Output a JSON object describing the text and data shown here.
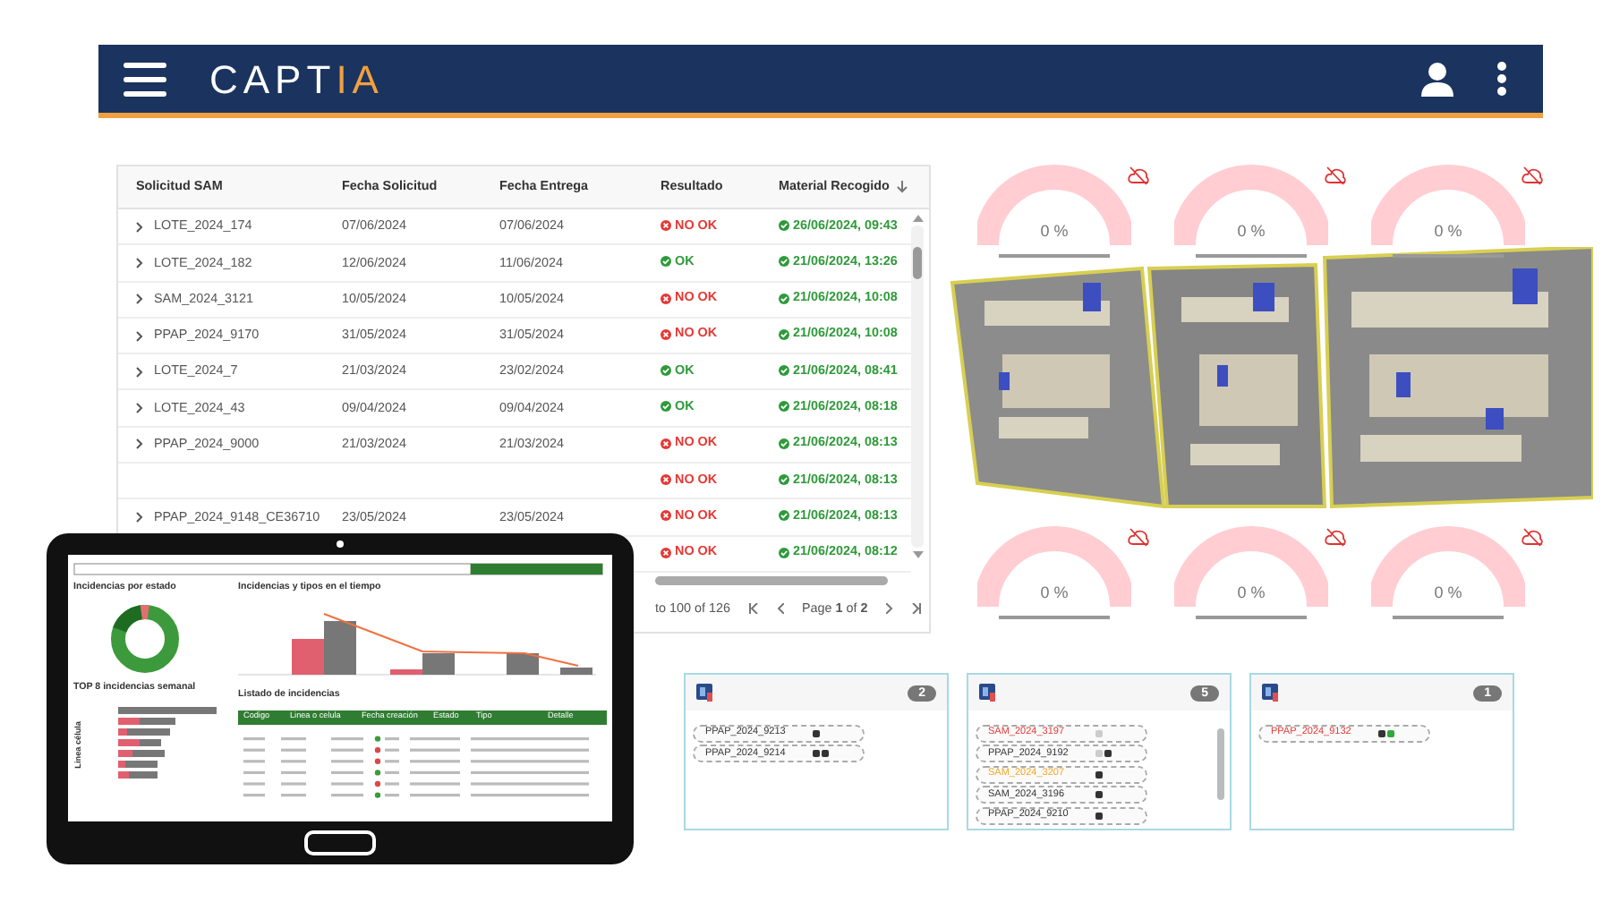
{
  "header": {
    "logo_main": "CAPT",
    "logo_accent": "IA"
  },
  "table": {
    "columns": [
      {
        "label": "Solicitud SAM",
        "sorted": false
      },
      {
        "label": "Fecha Solicitud",
        "sorted": false
      },
      {
        "label": "Fecha Entrega",
        "sorted": false
      },
      {
        "label": "Resultado",
        "sorted": false
      },
      {
        "label": "Material Recogido",
        "sorted": true
      }
    ],
    "rows": [
      {
        "request": "LOTE_2024_174",
        "requested": "07/06/2024",
        "delivered": "07/06/2024",
        "result": {
          "text": "NO OK",
          "ok": false
        },
        "collected": "26/06/2024, 09:43"
      },
      {
        "request": "LOTE_2024_182",
        "requested": "12/06/2024",
        "delivered": "11/06/2024",
        "result": {
          "text": "OK",
          "ok": true
        },
        "collected": "21/06/2024, 13:26"
      },
      {
        "request": "SAM_2024_3121",
        "requested": "10/05/2024",
        "delivered": "10/05/2024",
        "result": {
          "text": "NO OK",
          "ok": false
        },
        "collected": "21/06/2024, 10:08"
      },
      {
        "request": "PPAP_2024_9170",
        "requested": "31/05/2024",
        "delivered": "31/05/2024",
        "result": {
          "text": "NO OK",
          "ok": false
        },
        "collected": "21/06/2024, 10:08"
      },
      {
        "request": "LOTE_2024_7",
        "requested": "21/03/2024",
        "delivered": "23/02/2024",
        "result": {
          "text": "OK",
          "ok": true
        },
        "collected": "21/06/2024, 08:41"
      },
      {
        "request": "LOTE_2024_43",
        "requested": "09/04/2024",
        "delivered": "09/04/2024",
        "result": {
          "text": "OK",
          "ok": true
        },
        "collected": "21/06/2024, 08:18"
      },
      {
        "request": "PPAP_2024_9000",
        "requested": "21/03/2024",
        "delivered": "21/03/2024",
        "result": {
          "text": "NO OK",
          "ok": false
        },
        "collected": "21/06/2024, 08:13"
      },
      {
        "result": {
          "text": "NO OK",
          "ok": false
        },
        "collected": "21/06/2024, 08:13"
      },
      {
        "request": "PPAP_2024_9148_CE36710",
        "requested": "23/05/2024",
        "delivered": "23/05/2024",
        "result": {
          "text": "NO OK",
          "ok": false
        },
        "collected": "21/06/2024, 08:13"
      },
      {
        "result": {
          "text": "NO OK",
          "ok": false
        },
        "collected": "21/06/2024, 08:12"
      }
    ],
    "footer": "to 100 of 126",
    "pager": "Page **1** of **2**"
  },
  "gauges": [
    {
      "reading": "0 %"
    },
    {
      "reading": "0 %"
    },
    {
      "reading": "0 %"
    },
    {
      "reading": "0 %"
    },
    {
      "reading": "0 %"
    },
    {
      "reading": "0 %"
    }
  ],
  "cards": [
    {
      "count": "2",
      "scroll": false,
      "items": [
        {
          "label": "PPAP_2024_9213",
          "color": "#333333",
          "dots": [
            {
              "color": "#333333"
            }
          ]
        },
        {
          "label": "PPAP_2024_9214",
          "color": "#333333",
          "dots": [
            {
              "color": "#333333"
            },
            {
              "color": "#333333"
            }
          ]
        }
      ]
    },
    {
      "count": "5",
      "scroll": true,
      "items": [
        {
          "label": "SAM_2024_3197",
          "color": "#e53935",
          "dots": [
            {
              "color": "#cccccc"
            }
          ]
        },
        {
          "label": "PPAP_2024_9192",
          "color": "#333333",
          "dots": [
            {
              "color": "#cccccc"
            },
            {
              "color": "#333333"
            }
          ]
        },
        {
          "label": "SAM_2024_3207",
          "color": "#f5a623",
          "dots": [
            {
              "color": "#333333"
            }
          ]
        },
        {
          "label": "SAM_2024_3196",
          "color": "#333333",
          "dots": [
            {
              "color": "#333333"
            }
          ]
        },
        {
          "label": "PPAP_2024_9210",
          "color": "#333333",
          "dots": [
            {
              "color": "#333333"
            }
          ]
        }
      ]
    },
    {
      "count": "1",
      "scroll": false,
      "items": [
        {
          "label": "PPAP_2024_9132",
          "color": "#e53935",
          "dots": [
            {
              "color": "#333333"
            },
            {
              "color": "#2eaa3a"
            }
          ]
        }
      ]
    }
  ],
  "tablet": {
    "timeline": {
      "level": 0.25
    },
    "donut_title": "Incidencias por estado",
    "trend_title": "Incidencias y tipos en el tiempo",
    "top_title": "TOP 8 incidencias semanal",
    "top_axis_label": "Linea célula",
    "list_title": "Listado de incidencias",
    "list_columns": [
      "Codigo",
      "Linea o celula",
      "Fecha creación",
      "Estado",
      "Tipo",
      "Detalle"
    ]
  }
}
